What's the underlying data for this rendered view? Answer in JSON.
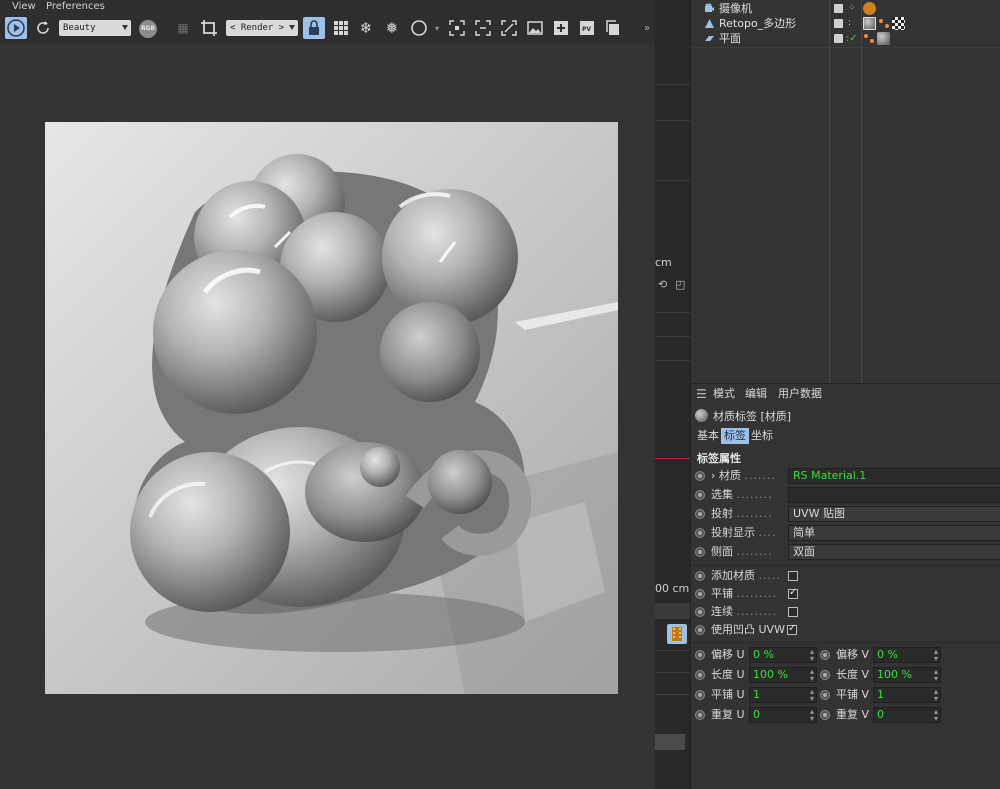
{
  "render_view": {
    "menu": [
      "View",
      "Preferences"
    ],
    "aov_dropdown": "Beauty",
    "rgb_badge": "RGB",
    "mode_dropdown": "< Render >",
    "pv_label": "PV"
  },
  "viewport_strip": {
    "unit_text_1": "cm",
    "unit_text_2": "00 cm"
  },
  "object_manager": {
    "rows": [
      {
        "name": "摄像机",
        "icon": "camera-icon"
      },
      {
        "name": "Retopo_多边形",
        "icon": "polygon-object-icon"
      },
      {
        "name": "平面",
        "icon": "plane-object-icon"
      }
    ]
  },
  "attribute_manager": {
    "menu": [
      "模式",
      "编辑",
      "用户数据"
    ],
    "title": "材质标签 [材质]",
    "tabs": [
      "基本",
      "标签",
      "坐标"
    ],
    "active_tab": "标签",
    "section_title": "标签属性",
    "properties": [
      {
        "label": "› 材质",
        "value": "RS Material.1",
        "kind": "field-green"
      },
      {
        "label": "选集",
        "value": "",
        "kind": "field"
      },
      {
        "label": "投射",
        "value": "UVW 贴图",
        "kind": "field"
      },
      {
        "label": "投射显示",
        "value": "简单",
        "kind": "field"
      },
      {
        "label": "侧面",
        "value": "双面",
        "kind": "field"
      }
    ],
    "checks": [
      {
        "label": "添加材质",
        "checked": false
      },
      {
        "label": "平铺",
        "checked": true
      },
      {
        "label": "连续",
        "checked": false
      },
      {
        "label": "使用凹凸 UVW",
        "checked": true
      }
    ],
    "uv_grid": [
      {
        "left_label": "偏移 U",
        "left_value": "0 %",
        "right_label": "偏移 V",
        "right_value": "0 %"
      },
      {
        "left_label": "长度 U",
        "left_value": "100 %",
        "right_label": "长度 V",
        "right_value": "100 %"
      },
      {
        "left_label": "平铺 U",
        "left_value": "1",
        "right_label": "平铺 V",
        "right_value": "1"
      },
      {
        "left_label": "重复 U",
        "left_value": "0",
        "right_label": "重复 V",
        "right_value": "0"
      }
    ]
  },
  "colors": {
    "accent_blue": "#9cc0e6",
    "value_green": "#38e038",
    "panel_bg": "#333333"
  }
}
